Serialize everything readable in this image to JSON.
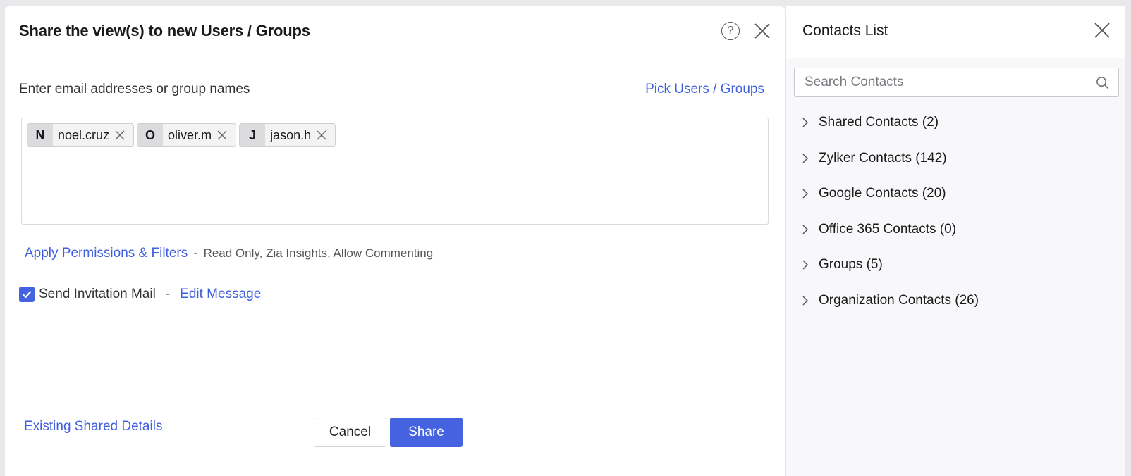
{
  "dialog": {
    "title": "Share the view(s) to new Users / Groups",
    "help_icon": "?",
    "field_label": "Enter email addresses or group names",
    "pick_link": "Pick Users / Groups",
    "recipients": [
      {
        "initial": "N",
        "name": "noel.cruz"
      },
      {
        "initial": "O",
        "name": "oliver.m"
      },
      {
        "initial": "J",
        "name": "jason.h"
      }
    ],
    "permissions_link": "Apply Permissions & Filters",
    "permissions_separator": "-",
    "permissions_summary": "Read Only, Zia Insights, Allow Commenting",
    "invite_label": "Send Invitation Mail",
    "invite_checked": true,
    "invite_separator": "-",
    "edit_message_link": "Edit Message",
    "existing_link": "Existing Shared Details",
    "cancel_label": "Cancel",
    "share_label": "Share"
  },
  "contacts": {
    "title": "Contacts List",
    "search_placeholder": "Search Contacts",
    "groups": [
      {
        "label": "Shared Contacts (2)"
      },
      {
        "label": "Zylker Contacts (142)"
      },
      {
        "label": "Google Contacts (20)"
      },
      {
        "label": "Office 365 Contacts (0)"
      },
      {
        "label": "Groups (5)"
      },
      {
        "label": "Organization Contacts (26)"
      }
    ]
  },
  "colors": {
    "accent": "#4563e1",
    "link": "#3f5ee0"
  },
  "icons": {
    "help": "question-circle-icon",
    "close": "close-x-icon",
    "chip_remove": "small-x-icon",
    "check": "checkmark-icon",
    "search": "magnifier-icon",
    "expand": "chevron-right-icon"
  }
}
